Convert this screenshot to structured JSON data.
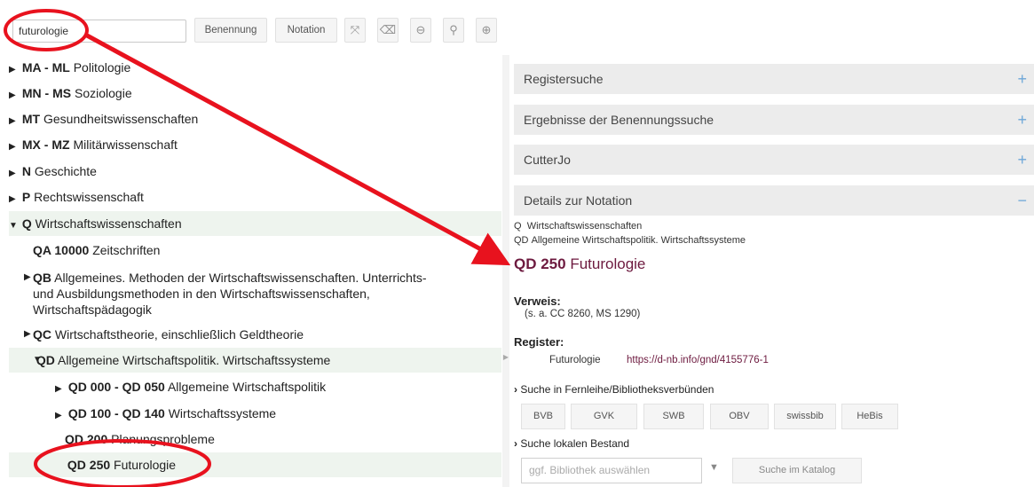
{
  "toolbar": {
    "search_value": "futurologie",
    "buttons": {
      "benennung": "Benennung",
      "notation": "Notation"
    },
    "icons": {
      "expand": "⤧",
      "eraser": "⌫",
      "zoom_out": "⊖",
      "search": "⚲",
      "zoom_in": "⊕"
    }
  },
  "tree": [
    {
      "code": "MA - ML",
      "label": "Politologie",
      "state": "collapsed"
    },
    {
      "code": "MN - MS",
      "label": "Soziologie",
      "state": "collapsed"
    },
    {
      "code": "MT",
      "label": "Gesundheitswissenschaften",
      "state": "collapsed"
    },
    {
      "code": "MX - MZ",
      "label": "Militärwissenschaft",
      "state": "collapsed"
    },
    {
      "code": "N",
      "label": "Geschichte",
      "state": "collapsed"
    },
    {
      "code": "P",
      "label": "Rechtswissenschaft",
      "state": "collapsed"
    },
    {
      "code": "Q",
      "label": "Wirtschaftswissenschaften",
      "state": "expanded"
    },
    {
      "code": "QA 10000",
      "label": "Zeitschriften",
      "state": "leaf"
    },
    {
      "code": "QB",
      "label": "Allgemeines. Methoden der Wirtschaftswissenschaften. Unterrichts-",
      "label2": "und Ausbildungsmethoden in den Wirtschaftswissenschaften,",
      "label3": "Wirtschaftspädagogik",
      "state": "collapsed"
    },
    {
      "code": "QC",
      "label": "Wirtschaftstheorie, einschließlich Geldtheorie",
      "state": "collapsed"
    },
    {
      "code": "QD",
      "label": "Allgemeine Wirtschaftspolitik. Wirtschaftssysteme",
      "state": "expanded"
    },
    {
      "code": "QD 000 - QD 050",
      "label": "Allgemeine Wirtschaftspolitik",
      "state": "collapsed"
    },
    {
      "code": "QD 100 - QD 140",
      "label": "Wirtschaftssysteme",
      "state": "collapsed"
    },
    {
      "code": "QD 200",
      "label": "Planungsprobleme",
      "state": "leaf"
    },
    {
      "code": "QD 250",
      "label": "Futurologie",
      "state": "leaf"
    }
  ],
  "panels": {
    "registersuche": "Registersuche",
    "ergebnisse": "Ergebnisse der Benennungssuche",
    "cutterjo": "CutterJo",
    "details": "Details zur Notation",
    "plus": "+",
    "minus": "−"
  },
  "details": {
    "breadcrumb_1_code": "Q",
    "breadcrumb_1_label": "Wirtschaftswissenschaften",
    "breadcrumb_2_code": "QD",
    "breadcrumb_2_label": "Allgemeine Wirtschaftspolitik. Wirtschaftssysteme",
    "title_code": "QD 250",
    "title_label": "Futurologie",
    "verweis_label": "Verweis:",
    "verweis_value": "(s. a. CC 8260, MS 1290)",
    "register_label": "Register:",
    "register_term": "Futurologie",
    "register_link": "https://d-nb.info/gnd/4155776-1",
    "fernleihe_label": "Suche in Fernleihe/Bibliotheksverbünden",
    "libraries": [
      "BVB",
      "GVK",
      "SWB",
      "OBV",
      "swissbib",
      "HeBis"
    ],
    "lokal_label": "Suche lokalen Bestand",
    "library_placeholder": "ggf. Bibliothek auswählen",
    "catalog_button": "Suche im Katalog"
  },
  "colors": {
    "annotation": "#e8121e",
    "link": "#6d1a3f",
    "highlight_row": "#eef4ee",
    "panel_header": "#ececec",
    "plus_icon": "#6ea7d8"
  }
}
